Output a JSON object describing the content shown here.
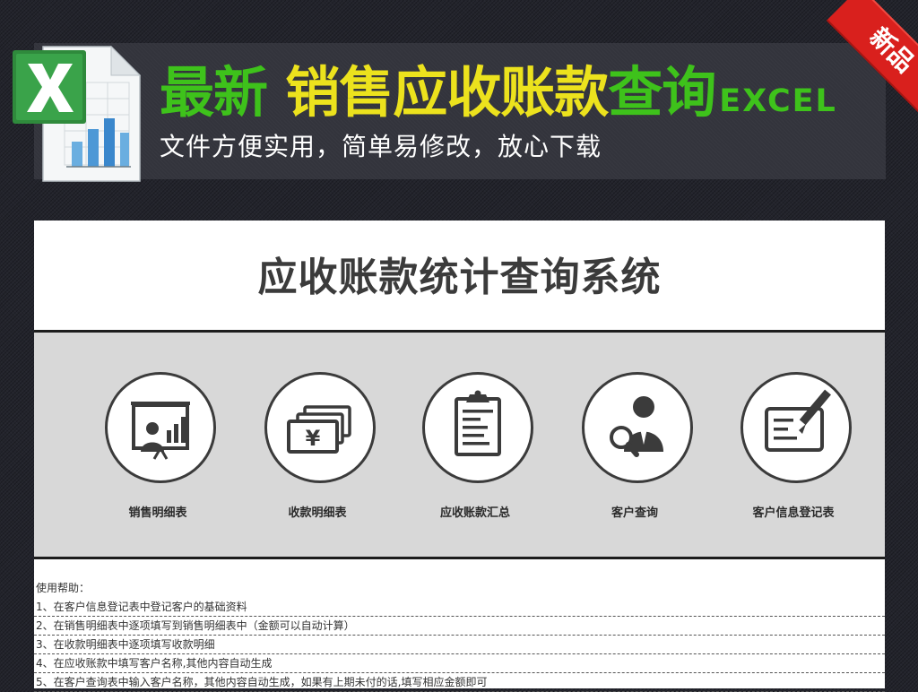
{
  "banner": {
    "title_part1": "最新",
    "title_part2": "销售应收账款",
    "title_part3": "查询",
    "title_suffix": "EXCEL",
    "subtitle": "文件方便实用，简单易修改，放心下载",
    "ribbon": "新品"
  },
  "system": {
    "title": "应收账款统计查询系统"
  },
  "nav": [
    {
      "label": "销售明细表",
      "icon": "presentation-chart-icon"
    },
    {
      "label": "收款明细表",
      "icon": "yen-bills-icon"
    },
    {
      "label": "应收账款汇总",
      "icon": "clipboard-icon"
    },
    {
      "label": "客户查询",
      "icon": "person-search-icon"
    },
    {
      "label": "客户信息登记表",
      "icon": "form-pen-icon"
    }
  ],
  "help": {
    "title": "使用帮助：",
    "items": [
      "1、在客户信息登记表中登记客户的基础资料",
      "2、在销售明细表中逐项填写到销售明细表中（金额可以自动计算）",
      "3、在收款明细表中逐项填写收款明细",
      "4、在应收账款中填写客户名称,其他内容自动生成",
      "5、在客户查询表中输入客户名称，其他内容自动生成，如果有上期未付的话,填写相应金额即可"
    ]
  },
  "colors": {
    "title_green": "#3ec21b",
    "title_yellow": "#ece21d",
    "ribbon_red": "#d9201d",
    "nav_background": "#d8d8d8",
    "icon_dark": "#3b3b3b"
  }
}
